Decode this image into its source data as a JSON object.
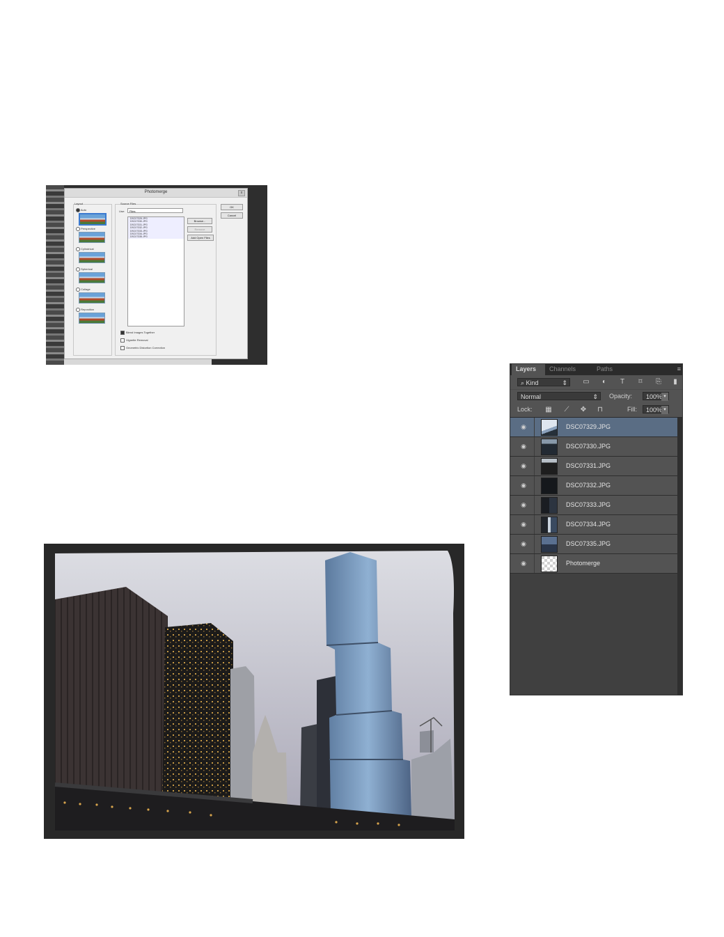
{
  "photomerge_dialog": {
    "title": "Photomerge",
    "close": "x",
    "layout_title": "Layout",
    "layout_options": [
      "Auto",
      "Perspective",
      "Cylindrical",
      "Spherical",
      "Collage",
      "Reposition"
    ],
    "source_title": "Source Files",
    "use_label": "Use:",
    "use_value": "Files",
    "files": [
      "DSC07329.JPG",
      "DSC07330.JPG",
      "DSC07331.JPG",
      "DSC07332.JPG",
      "DSC07333.JPG",
      "DSC07334.JPG",
      "DSC07335.JPG"
    ],
    "browse": "Browse...",
    "remove": "Remove",
    "add_open": "Add Open Files",
    "ok": "OK",
    "cancel": "Cancel",
    "blend": "Blend Images Together",
    "vignette": "Vignette Removal",
    "distortion": "Geometric Distortion Correction"
  },
  "layers_panel": {
    "tabs": [
      "Layers",
      "Channels",
      "Paths"
    ],
    "menu_icon": "≡",
    "kind": "Kind",
    "blend_mode": "Normal",
    "opacity_label": "Opacity:",
    "opacity_value": "100%",
    "lock_label": "Lock:",
    "fill_label": "Fill:",
    "fill_value": "100%",
    "layers": [
      {
        "name": "DSC07329.JPG",
        "selected": true
      },
      {
        "name": "DSC07330.JPG",
        "selected": false
      },
      {
        "name": "DSC07331.JPG",
        "selected": false
      },
      {
        "name": "DSC07332.JPG",
        "selected": false
      },
      {
        "name": "DSC07333.JPG",
        "selected": false
      },
      {
        "name": "DSC07334.JPG",
        "selected": false
      },
      {
        "name": "DSC07335.JPG",
        "selected": false
      },
      {
        "name": "Photomerge",
        "selected": false
      }
    ],
    "colors": {
      "panel": "#535353",
      "selected": "#5a6d84",
      "text": "#e4e4e4"
    }
  },
  "panorama": {
    "subject": "Chicago river skyline with glass tower"
  }
}
